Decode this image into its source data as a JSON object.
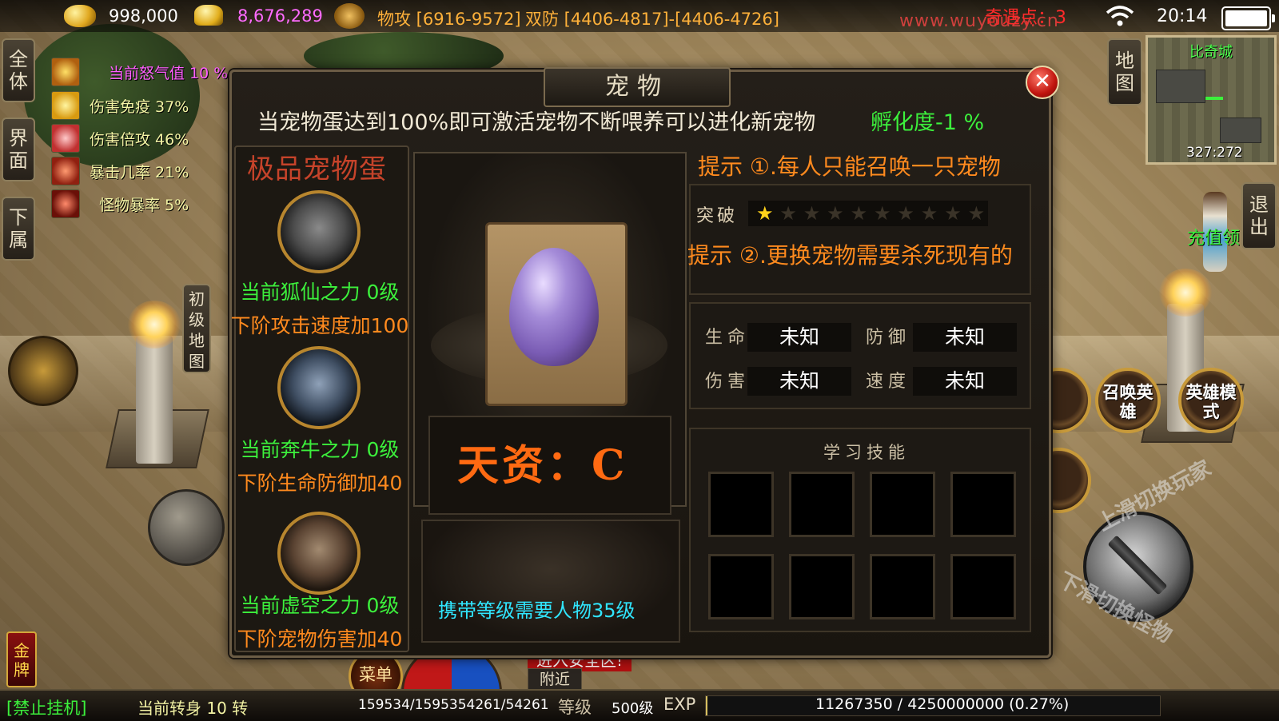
{
  "top_bar": {
    "gold": "998,000",
    "ingots": "8,676,289",
    "attack_label": "物攻 [6916-9572]",
    "defense_label": "双防 [4406-4817]-[4406-4726]",
    "watermark": "www.wuyouzy.cn",
    "adventure_points": "奇遇点：3",
    "time": "20:14"
  },
  "left_tabs": [
    {
      "label": "全体"
    },
    {
      "label": "界面"
    },
    {
      "label": "下属"
    }
  ],
  "buffs": [
    {
      "text": "当前怒气值 10 %",
      "color": "#ff5fff"
    },
    {
      "text": "伤害免疫 37%",
      "color": "#f3f3a4"
    },
    {
      "text": "伤害倍攻 46%",
      "color": "#f3f3a4"
    },
    {
      "text": "暴击几率 21%",
      "color": "#f3f3a4"
    },
    {
      "text": "怪物暴率 5%",
      "color": "#f3f3a4"
    }
  ],
  "beginner_map_label": "初级地图",
  "map": {
    "tab_label": "地图",
    "city": "比奇城",
    "coords": "327:272"
  },
  "exit_label": "退出",
  "recharge_label": "充值领",
  "right_buttons": {
    "summon_hero": "召唤英雄",
    "hero_mode": "英雄模式",
    "swipe_up": "上滑切换玩家",
    "swipe_down": "下滑切换怪物"
  },
  "bottom_bar": {
    "no_afk": "[禁止挂机]",
    "gold_tag": "金牌",
    "rebirth": "当前转身 10 转",
    "hp_mp": "159534/1595354261/54261",
    "level_label": "等级",
    "level": "500级",
    "exp_label": "EXP",
    "exp_value": "11267350 / 4250000000 (0.27%)",
    "menu": "菜单",
    "nearby": "附近",
    "safe_zone": "进入安全区!"
  },
  "dialog": {
    "title": "宠物",
    "notice": "当宠物蛋达到100%即可激活宠物不断喂养可以进化新宠物",
    "hatch": "孵化度-1 %",
    "pet_list_title": "极品宠物蛋",
    "pets": [
      {
        "name": "当前狐仙之力 0级",
        "bonus": "下阶攻击速度加100"
      },
      {
        "name": "当前奔牛之力 0级",
        "bonus": "下阶生命防御加40"
      },
      {
        "name": "当前虚空之力 0级",
        "bonus": "下阶宠物伤害加40"
      }
    ],
    "aptitude": "天资：C",
    "carry_requirement": "携带等级需要人物35级",
    "tip1": "提示 ①.每人只能召唤一只宠物",
    "tip2": "提示 ②.更换宠物需要杀死现有的",
    "breakthrough_label": "突破",
    "breakthrough_stars": 1,
    "breakthrough_max": 10,
    "stats": {
      "hp_label": "生命",
      "hp_value": "未知",
      "def_label": "防御",
      "def_value": "未知",
      "dmg_label": "伤害",
      "dmg_value": "未知",
      "spd_label": "速度",
      "spd_value": "未知"
    },
    "skills_title": "学习技能",
    "skill_slots": 8
  }
}
